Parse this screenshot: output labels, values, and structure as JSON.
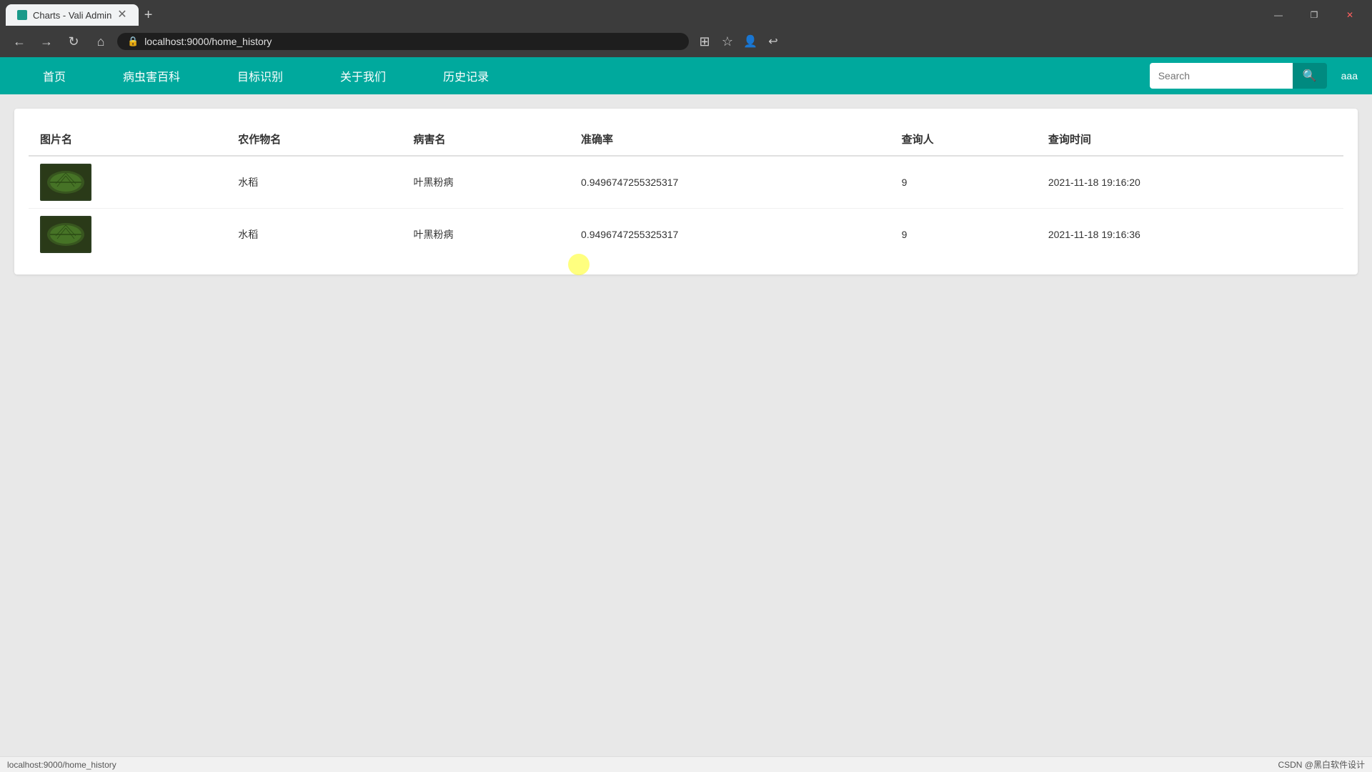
{
  "browser": {
    "tab_title": "Charts - Vali Admin",
    "url": "localhost:9000/home_history",
    "window_controls": [
      "—",
      "❐",
      "✕"
    ]
  },
  "nav": {
    "items": [
      {
        "label": "首页",
        "key": "home"
      },
      {
        "label": "病虫害百科",
        "key": "encyclopedia"
      },
      {
        "label": "目标识别",
        "key": "recognition"
      },
      {
        "label": "关于我们",
        "key": "about"
      },
      {
        "label": "历史记录",
        "key": "history"
      }
    ],
    "search_placeholder": "Search",
    "search_button_icon": "🔍",
    "user": "aaa"
  },
  "table": {
    "columns": [
      {
        "key": "image",
        "label": "图片名"
      },
      {
        "key": "crop",
        "label": "农作物名"
      },
      {
        "key": "disease",
        "label": "病害名"
      },
      {
        "key": "accuracy",
        "label": "准确率"
      },
      {
        "key": "querier",
        "label": "查询人"
      },
      {
        "key": "time",
        "label": "查询时间"
      }
    ],
    "rows": [
      {
        "image_alt": "leaf image 1",
        "crop": "水稻",
        "disease": "叶黑粉病",
        "accuracy": "0.9496747255325317",
        "querier": "9",
        "time": "2021-11-18 19:16:20"
      },
      {
        "image_alt": "leaf image 2",
        "crop": "水稻",
        "disease": "叶黑粉病",
        "accuracy": "0.9496747255325317",
        "querier": "9",
        "time": "2021-11-18 19:16:36"
      }
    ]
  },
  "status_bar": {
    "left": "localhost:9000/home_history",
    "right": "CSDN @黑白软件设计"
  }
}
